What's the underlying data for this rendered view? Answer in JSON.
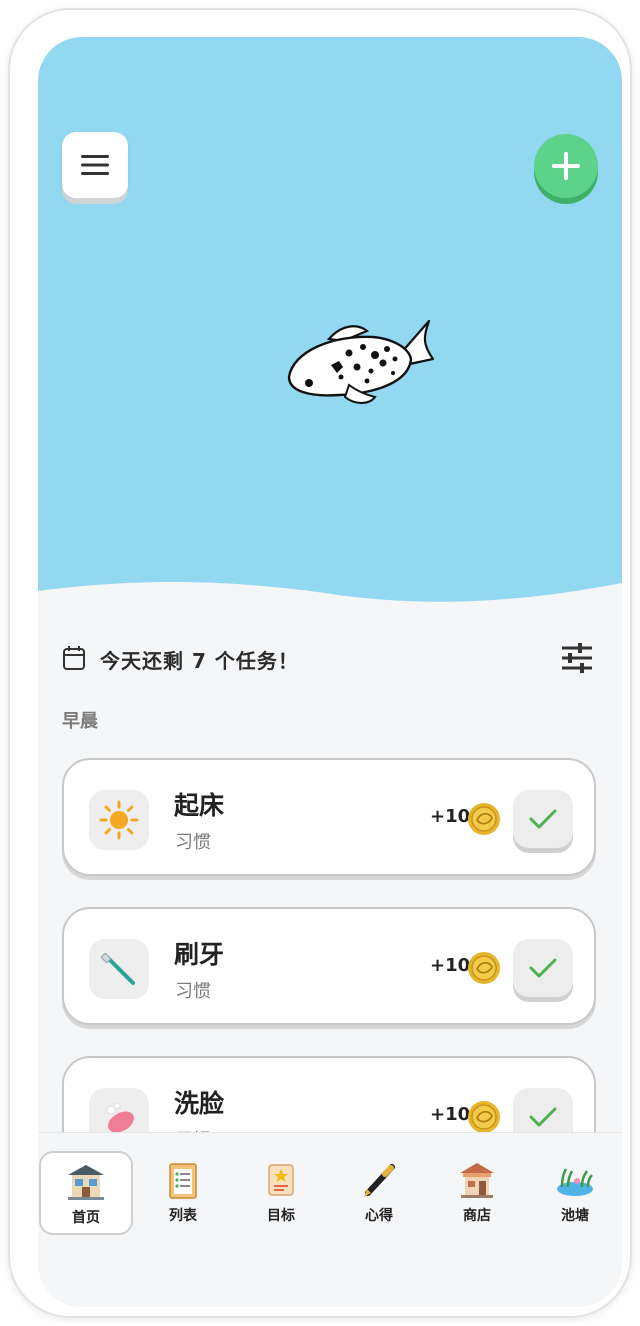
{
  "header": {
    "menu_icon": "hamburger-menu-icon",
    "add_icon": "plus-icon"
  },
  "summary": {
    "text": "今天还剩 7 个任务！",
    "calendar_icon": "calendar-icon",
    "filter_icon": "sliders-icon"
  },
  "section": {
    "label": "早晨"
  },
  "tasks": [
    {
      "title": "起床",
      "category": "习惯",
      "reward": "+10",
      "icon": "sun-icon"
    },
    {
      "title": "刷牙",
      "category": "习惯",
      "reward": "+10",
      "icon": "toothbrush-icon"
    },
    {
      "title": "洗脸",
      "category": "习惯",
      "reward": "+10",
      "icon": "soap-icon"
    }
  ],
  "tabs": [
    {
      "label": "首页",
      "icon": "house-icon",
      "active": true
    },
    {
      "label": "列表",
      "icon": "clipboard-list-icon",
      "active": false
    },
    {
      "label": "目标",
      "icon": "scroll-star-icon",
      "active": false
    },
    {
      "label": "心得",
      "icon": "pen-icon",
      "active": false
    },
    {
      "label": "商店",
      "icon": "shop-icon",
      "active": false
    },
    {
      "label": "池塘",
      "icon": "pond-icon",
      "active": false
    }
  ],
  "colors": {
    "sky": "#92d8f0",
    "accent_green": "#5cd389",
    "background": "#f5f6f8"
  }
}
